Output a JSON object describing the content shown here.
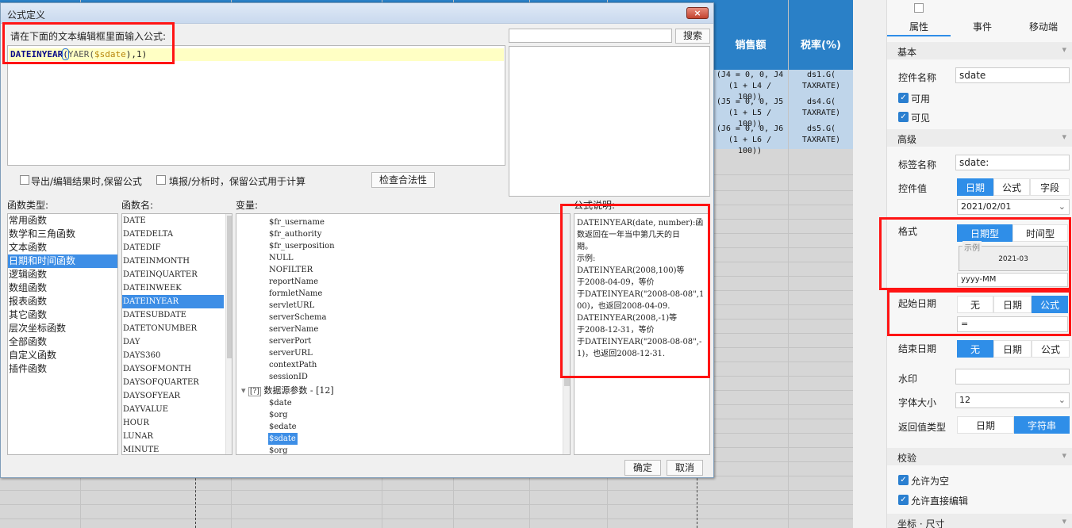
{
  "dialog": {
    "title": "公式定义",
    "close_icon": "×",
    "prompt": "请在下面的文本编辑框里面输入公式:",
    "formula": {
      "fn": "DATEINYEAR",
      "p1": "(",
      "fn2": "YAER(",
      "var": "$sdate",
      "rest": "),1)"
    },
    "search_button": "搜索",
    "option1": "导出/编辑结果时,保留公式",
    "option2": "填报/分析时，保留公式用于计算",
    "check_button": "检查合法性",
    "func_type_label": "函数类型:",
    "func_name_label": "函数名:",
    "var_label": "变量:",
    "desc_label": "公式说明:",
    "func_types": [
      "常用函数",
      "数学和三角函数",
      "文本函数",
      "日期和时间函数",
      "逻辑函数",
      "数组函数",
      "报表函数",
      "其它函数",
      "层次坐标函数",
      "全部函数",
      "自定义函数",
      "插件函数"
    ],
    "func_names": [
      "DATE",
      "DATEDELTA",
      "DATEDIF",
      "DATEINMONTH",
      "DATEINQUARTER",
      "DATEINWEEK",
      "DATEINYEAR",
      "DATESUBDATE",
      "DATETONUMBER",
      "DAY",
      "DAYS360",
      "DAYSOFMONTH",
      "DAYSOFQUARTER",
      "DAYSOFYEAR",
      "DAYVALUE",
      "HOUR",
      "LUNAR",
      "MINUTE"
    ],
    "variables": [
      "$fr_username",
      "$fr_authority",
      "$fr_userposition",
      "NULL",
      "NOFILTER",
      "reportName",
      "formletName",
      "servletURL",
      "serverSchema",
      "serverName",
      "serverPort",
      "serverURL",
      "contextPath",
      "sessionID"
    ],
    "ds_group": "数据源参数 - [12]",
    "ds_params": [
      "$date",
      "$org",
      "$edate",
      "$sdate",
      "$org"
    ],
    "description": "DATEINYEAR(date, number):函\n数返回在一年当中第几天的日\n期。\n示例:\nDATEINYEAR(2008,100)等\n于2008-04-09，等价\n于DATEINYEAR(\"2008-08-08\",1\n00)，也返回2008-04-09.\nDATEINYEAR(2008,-1)等\n于2008-12-31，等价\n于DATEINYEAR(\"2008-08-08\",-\n1)，也返回2008-12-31.",
    "ok_button": "确定",
    "cancel_button": "取消"
  },
  "report": {
    "headers": [
      "销售额",
      "税率(%)"
    ],
    "rows": [
      {
        "a1": "(J4 = 0, 0, J4",
        "a2": "(1 + L4 / 100))",
        "b1": "ds1.G(",
        "b2": "TAXRATE)"
      },
      {
        "a1": "(J5 = 0, 0, J5",
        "a2": "(1 + L5 / 100))",
        "b1": "ds4.G(",
        "b2": "TAXRATE)"
      },
      {
        "a1": "(J6 = 0, 0, J6",
        "a2": "(1 + L6 / 100))",
        "b1": "ds5.G(",
        "b2": "TAXRATE)"
      }
    ],
    "header_color": "#2a80c7"
  },
  "props": {
    "tabs": [
      "属性",
      "事件",
      "移动端"
    ],
    "basic": "基本",
    "name_label": "控件名称",
    "name_value": "sdate",
    "enabled": "可用",
    "visible": "可见",
    "advanced": "高级",
    "tag_label": "标签名称",
    "tag_value": "sdate:",
    "value_label": "控件值",
    "value_opts": [
      "日期",
      "公式",
      "字段"
    ],
    "value_date": "2021/02/01",
    "format_label": "格式",
    "format_opts": [
      "日期型",
      "时间型"
    ],
    "example_label": "示例",
    "example_value": "2021-03",
    "format_value": "yyyy-MM",
    "start_label": "起始日期",
    "start_opts": [
      "无",
      "日期",
      "公式"
    ],
    "start_value": "=",
    "end_label": "结束日期",
    "end_opts": [
      "无",
      "日期",
      "公式"
    ],
    "watermark_label": "水印",
    "fontsize_label": "字体大小",
    "fontsize_value": "12",
    "return_label": "返回值类型",
    "return_opts": [
      "日期",
      "字符串"
    ],
    "validate": "校验",
    "allow_empty": "允许为空",
    "allow_edit": "允许直接编辑",
    "coords": "坐标 · 尺寸",
    "accent": "#2f8ee8"
  }
}
